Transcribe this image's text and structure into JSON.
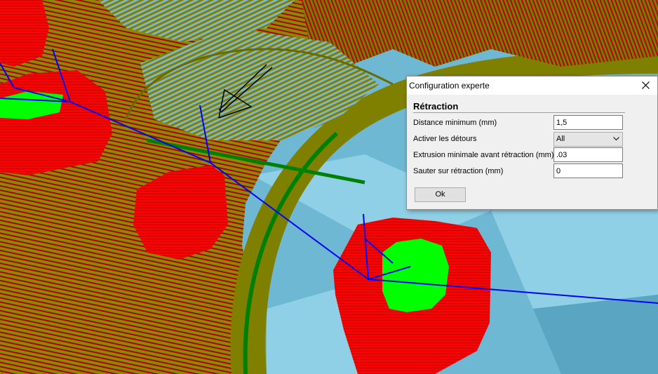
{
  "dialog": {
    "title": "Configuration experte",
    "section_title": "Rétraction",
    "fields": [
      {
        "label": "Distance minimum (mm)",
        "value": "1,5"
      },
      {
        "label": "Activer les détours",
        "value": "All"
      },
      {
        "label": "Extrusion minimale avant rétraction (mm)",
        "value": ".03"
      },
      {
        "label": "Sauter sur rétraction (mm)",
        "value": "0"
      }
    ],
    "ok_label": "Ok"
  },
  "viewport": {
    "colors": {
      "build_plate": "#6fb8d4",
      "plate_light": "#8fd0e6",
      "plate_shade": "#5aa5c2",
      "infill": "#808000",
      "wall": "#ff0000",
      "wall_dark": "#b00000",
      "top_skin": "#00ff00",
      "support": "#008000",
      "travel": "#0000ff"
    }
  }
}
